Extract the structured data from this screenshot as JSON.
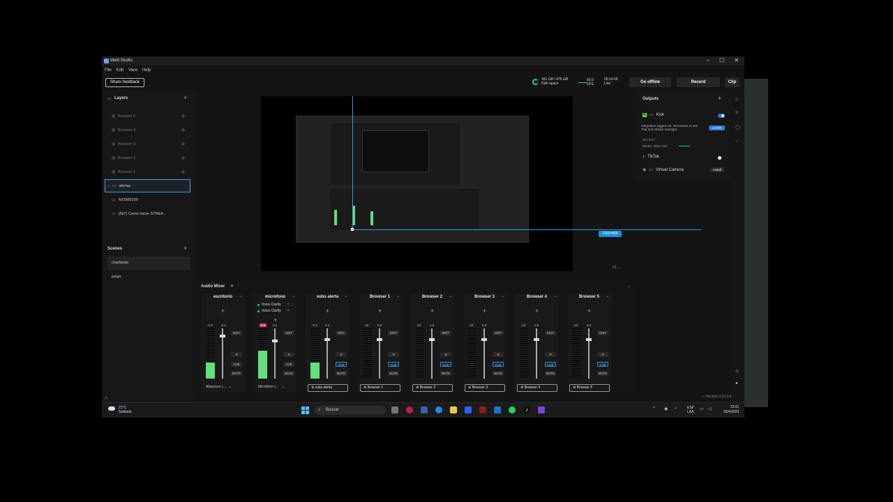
{
  "window": {
    "title": "Meld Studio",
    "controls": [
      "–",
      "☐",
      "✕"
    ]
  },
  "menu": [
    "File",
    "Edit",
    "View",
    "Help"
  ],
  "topbar": {
    "feedback": "Share feedback",
    "disk_value": "261 GB / 476 GB",
    "disk_label": "Disk space",
    "fps_value": "60.0",
    "fps_label": "FPS",
    "live_time": "00:10:09",
    "live_label": "Live",
    "go_offline": "Go offline",
    "record": "Record",
    "clip": "Clip"
  },
  "layers": {
    "title": "Layers",
    "items": [
      "Browser 5",
      "Browser 4",
      "Browser 3",
      "Browser 2",
      "Browser 1",
      "alertas",
      "NXSM2200",
      "(597) Como hacer STREA..."
    ]
  },
  "scenes": {
    "title": "Scenes",
    "items": [
      "charlando",
      "juego"
    ]
  },
  "canvas": {
    "dimensions": "1166×866",
    "zoom": "Fit"
  },
  "outputs": {
    "title": "Outputs",
    "kick": "Kick",
    "kick_warning": "Integration logged out. Reconnect to use chat and stream manager.",
    "login": "LOGIN",
    "elapsed": "00:10:07",
    "bitrate": "Bitrate: 5984 Kb/s",
    "tiktok": "TikTok",
    "virtual_camera": "Virtual Camera",
    "install": "Install"
  },
  "mixer": {
    "title": "Audio Mixer",
    "strips": [
      {
        "name": "escritorio",
        "db_left": "-6.0",
        "db_right": "-6.4",
        "source": "Altavoces (...",
        "level": 0.32,
        "fader": 0.88
      },
      {
        "name": "microfono",
        "db_left": "0.0",
        "db_right": "0.0",
        "source": "Micrófono (...",
        "level": 0.55,
        "fader": 0.78,
        "fx": [
          "Voice Clarity",
          "Voice Clarity"
        ]
      },
      {
        "name": "subs alerta",
        "db_left": "-6.3",
        "db_right": "0.0",
        "source": "subs alerta",
        "level": 0.32,
        "fader": 0.8
      },
      {
        "name": "Browser 1",
        "db_left": "-inf",
        "db_right": "0.0",
        "source": "Browser 1",
        "level": 0,
        "fader": 0.8
      },
      {
        "name": "Browser 2",
        "db_left": "-inf",
        "db_right": "0.0",
        "source": "Browser 2",
        "level": 0,
        "fader": 0.8
      },
      {
        "name": "Browser 3",
        "db_left": "-inf",
        "db_right": "0.0",
        "source": "Browser 3",
        "level": 0,
        "fader": 0.8
      },
      {
        "name": "Browser 4",
        "db_left": "-inf",
        "db_right": "0.0",
        "source": "Browser 4",
        "level": 0,
        "fader": 0.8
      },
      {
        "name": "Browser 5",
        "db_left": "-inf",
        "db_right": "0.0",
        "source": "Browser 5",
        "level": 0,
        "fader": 0.8
      }
    ],
    "edit": "EDIT",
    "cue": "CUE",
    "mute": "MUTE"
  },
  "version": "Version 0.10.0.3",
  "taskbar": {
    "temp": "21°C",
    "weather": "Nublado",
    "search": "Buscar",
    "lang1": "ESP",
    "lang2": "LAA",
    "time": "23:01",
    "date": "25/4/2026"
  },
  "colors": {
    "accent": "#2d9ee8",
    "meter": "#63e07d",
    "kick": "#53fc18",
    "clip_red": "#e0324f"
  }
}
